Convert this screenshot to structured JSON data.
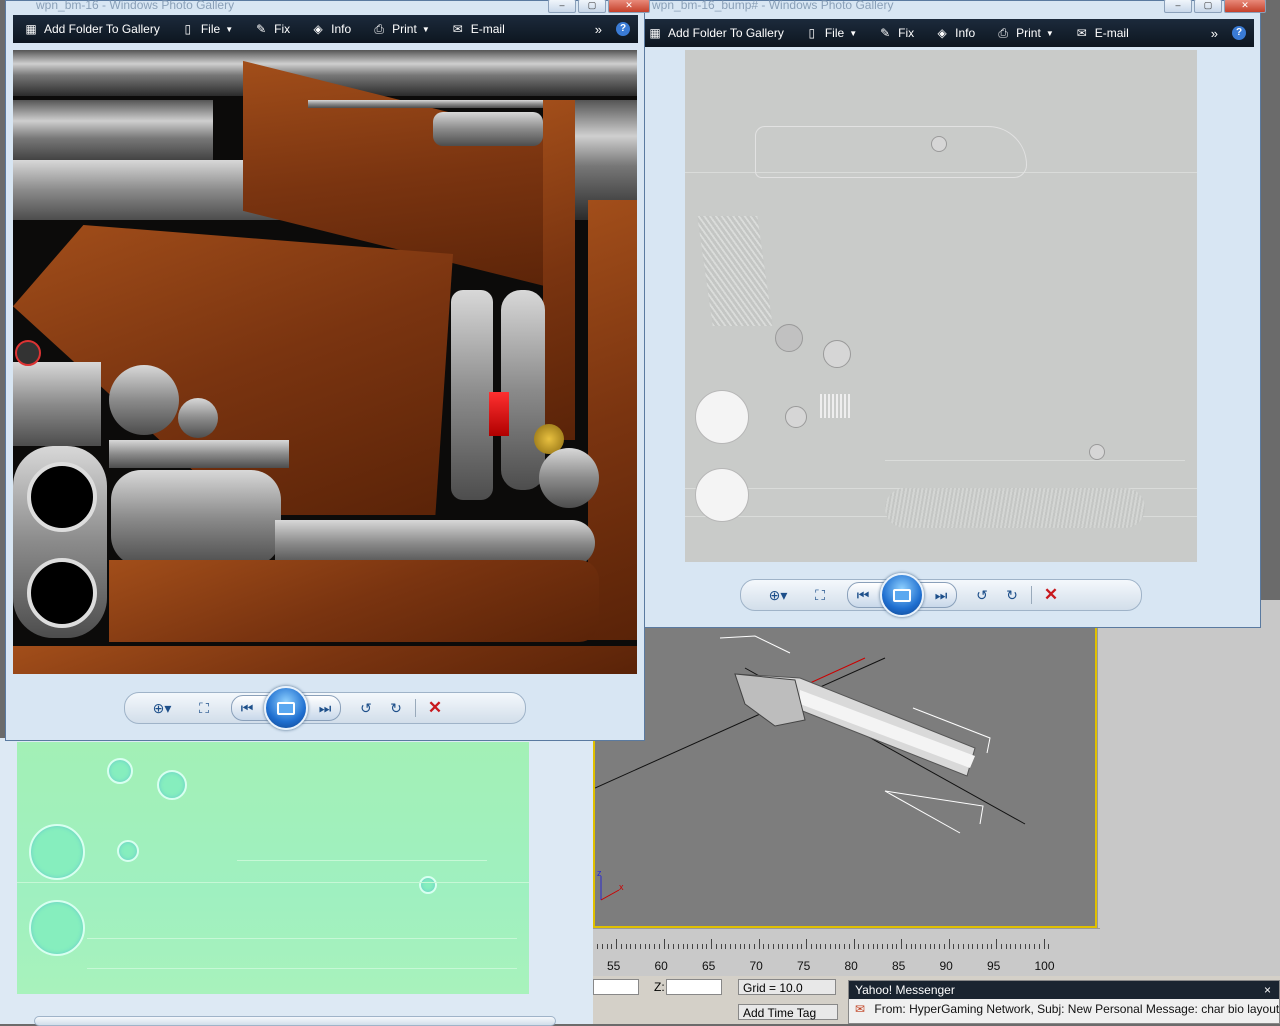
{
  "gallery_left": {
    "title": "wpn_bm-16 - Windows Photo Gallery",
    "toolbar": {
      "add_folder": "Add Folder To Gallery",
      "file": "File",
      "fix": "Fix",
      "info": "Info",
      "print": "Print",
      "email": "E-mail"
    }
  },
  "gallery_right": {
    "title": "wpn_bm-16_bump# - Windows Photo Gallery",
    "toolbar": {
      "add_folder": "Add Folder To Gallery",
      "file": "File",
      "fix": "Fix",
      "info": "Info",
      "print": "Print",
      "email": "E-mail"
    }
  },
  "viewport": {
    "axis_z": "z",
    "axis_x": "x"
  },
  "timeline": {
    "ticks": [
      "55",
      "60",
      "65",
      "70",
      "75",
      "80",
      "85",
      "90",
      "95",
      "100"
    ]
  },
  "status": {
    "z_label": "Z:",
    "grid": "Grid = 10.0",
    "add_time_tag": "Add Time Tag"
  },
  "messenger": {
    "title": "Yahoo! Messenger",
    "close": "×",
    "message": "From: HyperGaming Network, Subj: New Personal Message: char bio layout"
  },
  "colors": {
    "toolbar_bg": "#0d1620",
    "viewport_border": "#e0c000",
    "delete_red": "#c8191e"
  }
}
